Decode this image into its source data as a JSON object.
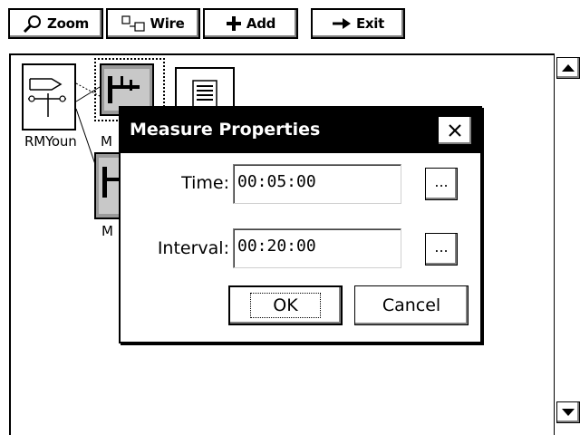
{
  "toolbar": {
    "zoom_label": "Zoom",
    "wire_label": "Wire",
    "add_label": "Add",
    "exit_label": "Exit"
  },
  "canvas": {
    "nodes": [
      {
        "label": "RMYoun",
        "icon": "wind-sensor-icon"
      },
      {
        "label": "M",
        "icon": "measure-icon"
      },
      {
        "label": "M",
        "icon": "measure-icon"
      },
      {
        "label": "",
        "icon": "document-icon"
      }
    ]
  },
  "dialog": {
    "title": "Measure Properties",
    "close_glyph": "✕",
    "fields": [
      {
        "label": "Time:",
        "value": "00:05:00",
        "browse_label": "..."
      },
      {
        "label": "Interval:",
        "value": "00:20:00",
        "browse_label": "..."
      }
    ],
    "ok_label": "OK",
    "cancel_label": "Cancel"
  },
  "colors": {
    "title_bar": "#000000",
    "title_text": "#ffffff",
    "button_shadow": "#808080",
    "background": "#ffffff"
  }
}
